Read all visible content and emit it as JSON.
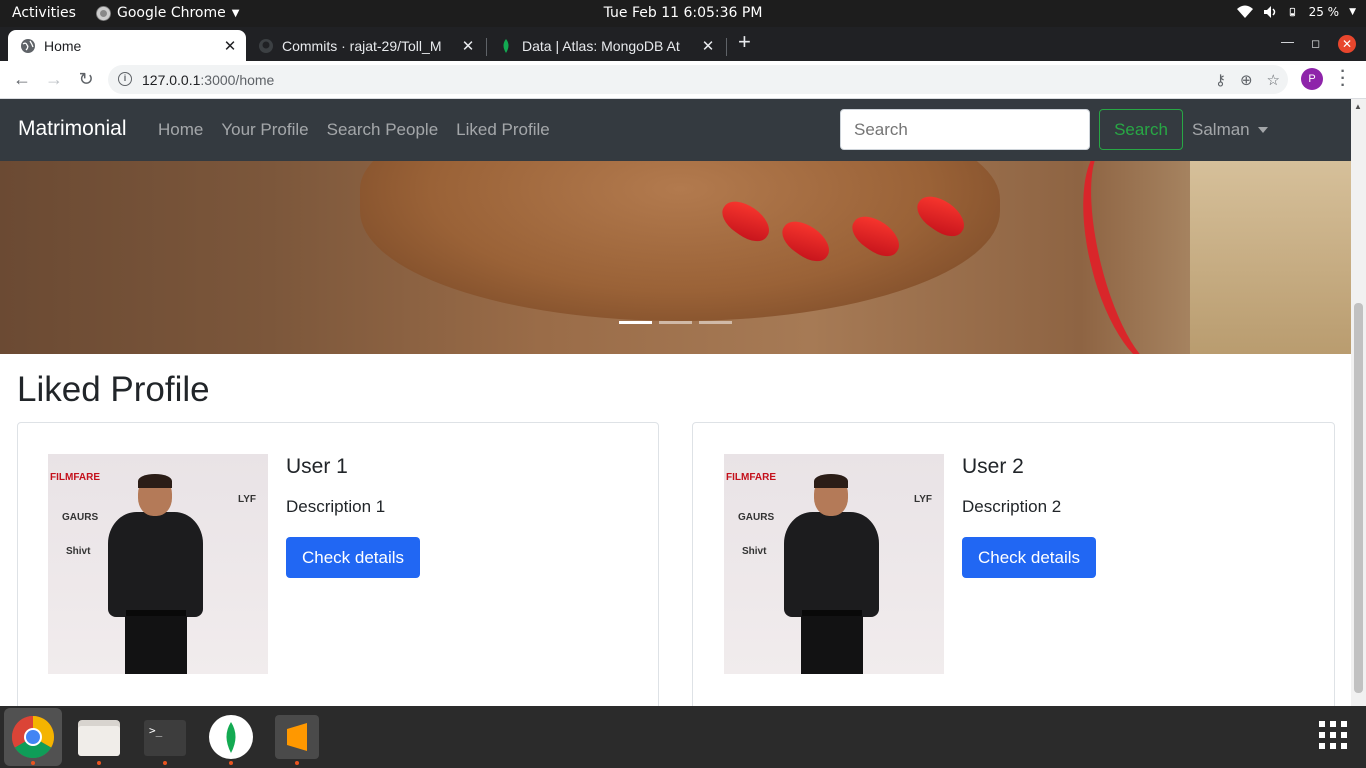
{
  "system": {
    "activities": "Activities",
    "app_name": "Google Chrome",
    "clock": "Tue Feb 11   6:05:36 PM",
    "battery": "25 %"
  },
  "browser": {
    "tabs": [
      {
        "title": "Home",
        "icon": "globe-icon"
      },
      {
        "title": "Commits · rajat-29/Toll_M",
        "icon": "github-icon"
      },
      {
        "title": "Data | Atlas: MongoDB At",
        "icon": "mongodb-leaf-icon"
      }
    ],
    "new_tab": "+",
    "url_host": "127.0.0.1",
    "url_path": ":3000/home",
    "profile_initial": "P"
  },
  "navbar": {
    "brand": "Matrimonial",
    "links": [
      "Home",
      "Your Profile",
      "Search People",
      "Liked Profile"
    ],
    "search_placeholder": "Search",
    "search_button": "Search",
    "user": "Salman"
  },
  "carousel": {
    "slides": 3,
    "active_index": 0
  },
  "liked": {
    "title": "Liked Profile",
    "cards": [
      {
        "name": "User 1",
        "description": "Description 1",
        "button": "Check details"
      },
      {
        "name": "User 2",
        "description": "Description 2",
        "button": "Check details"
      }
    ]
  },
  "photo_logos": [
    "FILMFARE",
    "GAURS",
    "LYF",
    "Shivt"
  ],
  "dock": [
    "chrome-icon",
    "files-icon",
    "terminal-icon",
    "mongodb-compass-icon",
    "sublime-text-icon"
  ],
  "colors": {
    "navbar_bg": "#343a40",
    "success": "#28a745",
    "primary": "#2167f3"
  }
}
